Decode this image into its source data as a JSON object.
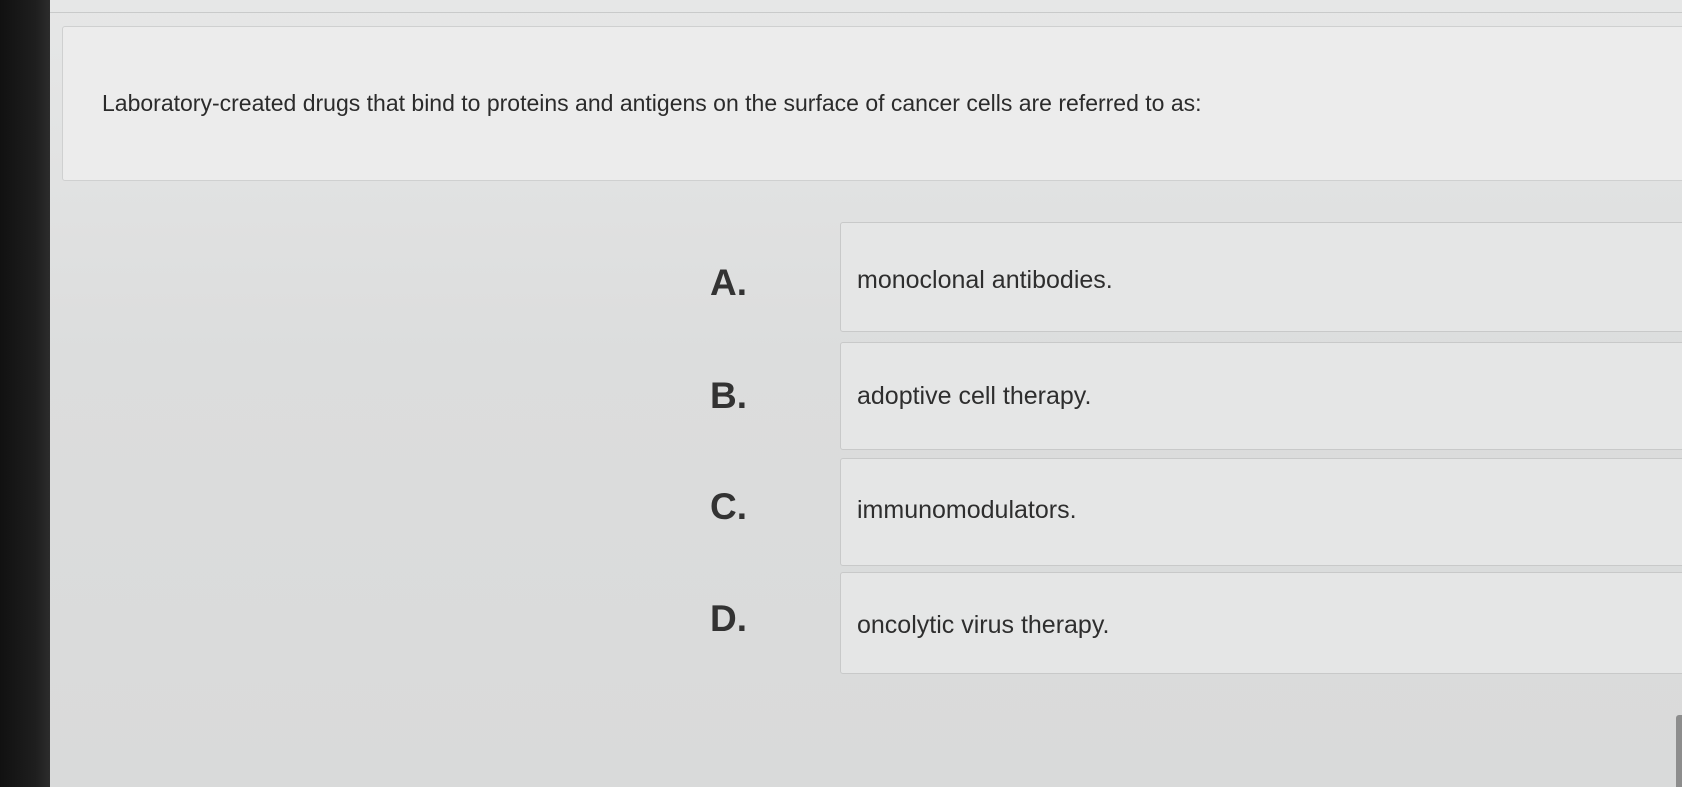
{
  "question": {
    "text": "Laboratory-created drugs that bind to proteins and antigens on the surface of cancer cells are referred to as:"
  },
  "options": [
    {
      "letter": "A.",
      "text": "monoclonal antibodies."
    },
    {
      "letter": "B.",
      "text": "adoptive cell therapy."
    },
    {
      "letter": "C.",
      "text": "immunomodulators."
    },
    {
      "letter": "D.",
      "text": "oncolytic virus therapy."
    }
  ]
}
